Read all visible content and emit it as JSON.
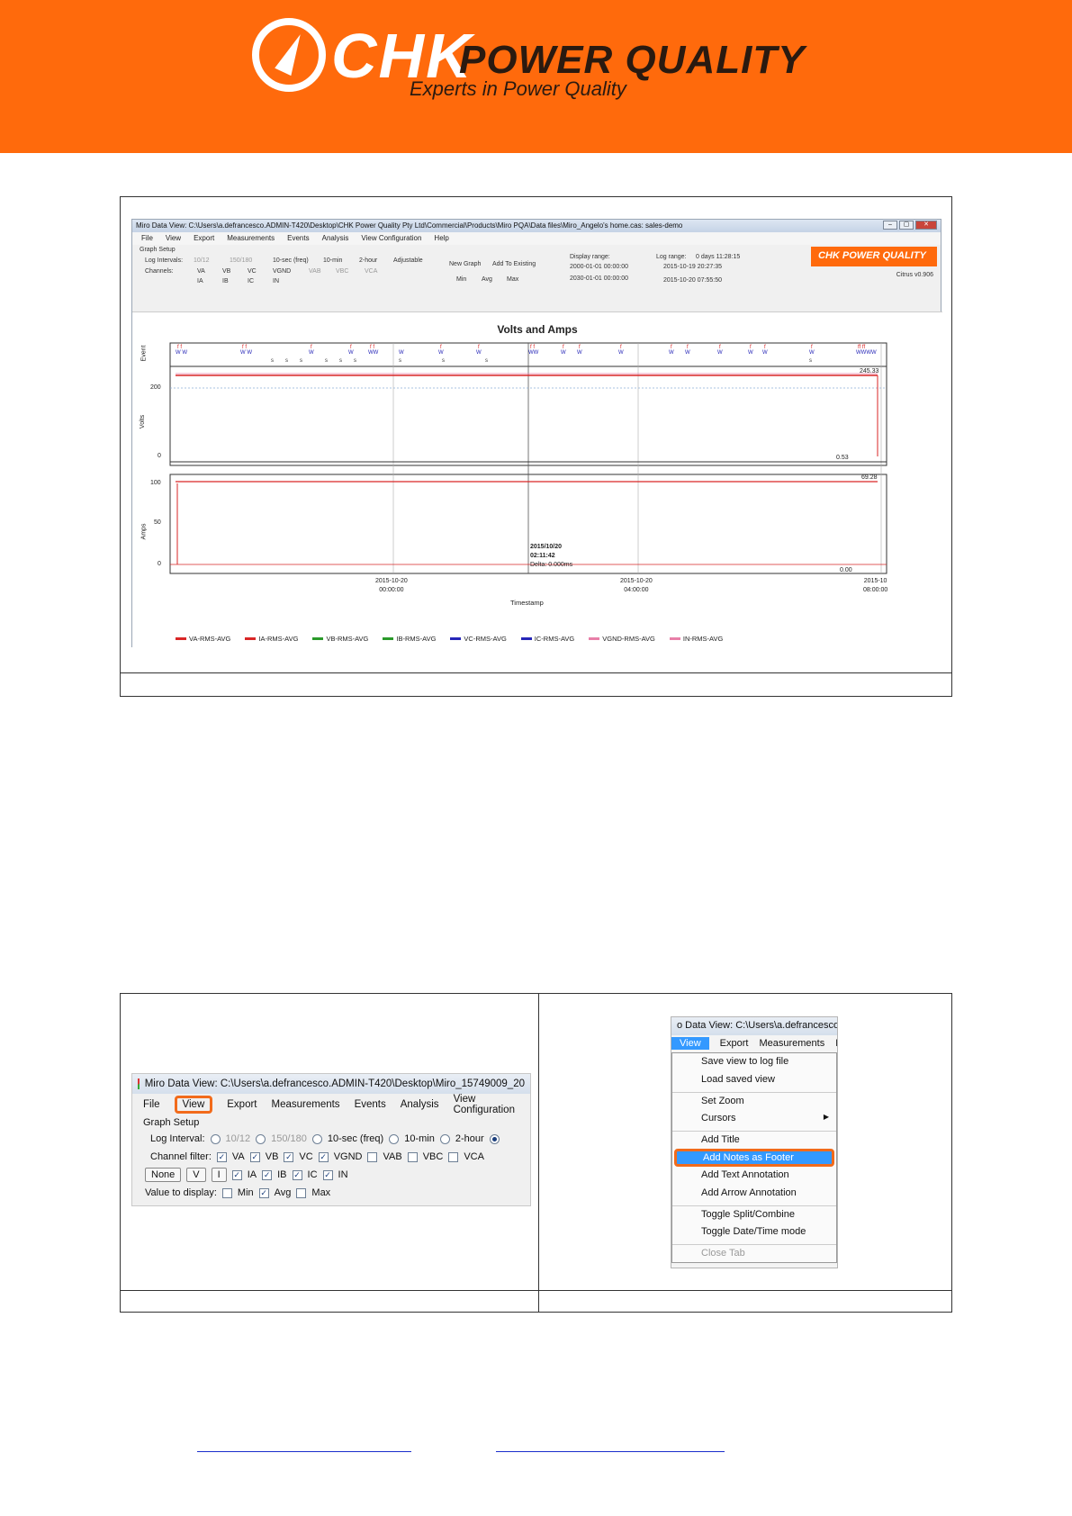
{
  "banner": {
    "logo_chk": "CHK",
    "logo_pq": "POWER QUALITY",
    "tagline": "Experts in Power Quality"
  },
  "figure1": {
    "window_title": "Miro Data View: C:\\Users\\a.defrancesco.ADMIN-T420\\Desktop\\CHK Power Quality Pty Ltd\\Commercial\\Products\\Miro PQA\\Data files\\Miro_Angelo's home.cas: sales-demo",
    "menu": [
      "File",
      "View",
      "Export",
      "Measurements",
      "Events",
      "Analysis",
      "View Configuration",
      "Help"
    ],
    "graph_setup": "Graph Setup",
    "log_intervals_label": "Log Intervals:",
    "log_intervals": [
      "10/12",
      "150/180",
      "10-sec (freq)",
      "10-min",
      "2-hour",
      "Adjustable"
    ],
    "channels_label": "Channels:",
    "channels_row1": [
      "VA",
      "VB",
      "VC",
      "VGND",
      "VAB",
      "VBC",
      "VCA"
    ],
    "channels_row2": [
      "IA",
      "IB",
      "IC",
      "IN"
    ],
    "graph_mode": [
      "New Graph",
      "Add To Existing"
    ],
    "values": [
      "Min",
      "Avg",
      "Max"
    ],
    "display_range_label": "Display range:",
    "display_from": "2000-01-01 00:00:00",
    "display_to": "2030-01-01 00:00:00",
    "log_range_label": "Log range:",
    "log_range_duration": "0 days 11:28:15",
    "log_range_start": "2015-10-19 20:27:35",
    "log_range_end": "2015-10-20 07:55:50",
    "brand_small": "CHK POWER QUALITY",
    "version": "Citrus v0.906",
    "chart_title": "Volts and Amps",
    "event_axis": "Event",
    "volts_axis": "Volts",
    "amps_axis": "Amps",
    "volts_ticks": [
      "200",
      "0"
    ],
    "amps_ticks": [
      "100",
      "50",
      "0"
    ],
    "volts_max": "245.33",
    "volts_min": "0.53",
    "amps_max": "69.28",
    "amps_min": "0.00",
    "cursor_date": "2015/10/20",
    "cursor_time": "02:11:42",
    "cursor_delta": "Delta: 0.000ms",
    "x_ticks": [
      {
        "date": "2015-10-20",
        "time": "00:00:00"
      },
      {
        "date": "2015-10-20",
        "time": "04:00:00"
      },
      {
        "date": "2015-10",
        "time": "08:00:00"
      }
    ],
    "x_label": "Timestamp",
    "legend": [
      {
        "name": "VA-RMS-AVG",
        "color": "#d92626"
      },
      {
        "name": "IA-RMS-AVG",
        "color": "#d92626"
      },
      {
        "name": "VB-RMS-AVG",
        "color": "#2a9a2a"
      },
      {
        "name": "IB-RMS-AVG",
        "color": "#2a9a2a"
      },
      {
        "name": "VC-RMS-AVG",
        "color": "#2626b8"
      },
      {
        "name": "IC-RMS-AVG",
        "color": "#2626b8"
      },
      {
        "name": "VGND-RMS-AVG",
        "color": "#e87fa8"
      },
      {
        "name": "IN-RMS-AVG",
        "color": "#e87fa8"
      }
    ],
    "event_markers": "f w s"
  },
  "left_shot": {
    "title": "Miro Data View: C:\\Users\\a.defrancesco.ADMIN-T420\\Desktop\\Miro_15749009_20",
    "menu": [
      "File",
      "View",
      "Export",
      "Measurements",
      "Events",
      "Analysis",
      "View Configuration"
    ],
    "graph_setup": "Graph Setup",
    "log_interval_label": "Log Interval:",
    "log_intervals": [
      "10/12",
      "150/180",
      "10-sec (freq)",
      "10-min",
      "2-hour"
    ],
    "channel_filter_label": "Channel filter:",
    "filter_row1": [
      "VA",
      "VB",
      "VC",
      "VGND",
      "VAB",
      "VBC",
      "VCA"
    ],
    "filter_row2": [
      "IA",
      "IB",
      "IC",
      "IN"
    ],
    "btn_none": "None",
    "btn_v": "V",
    "btn_i": "I",
    "value_label": "Value to display:",
    "values": [
      "Min",
      "Avg",
      "Max"
    ]
  },
  "right_shot": {
    "title": "o Data View: C:\\Users\\a.defrancesco.AD",
    "menu": [
      "View",
      "Export",
      "Measurements",
      "E"
    ],
    "items": [
      "Save view to log file",
      "Load saved view",
      "Set Zoom",
      "Cursors",
      "Add Title",
      "Add Notes as Footer",
      "Add Text Annotation",
      "Add Arrow Annotation",
      "Toggle Split/Combine",
      "Toggle Date/Time mode",
      "Close Tab"
    ]
  }
}
